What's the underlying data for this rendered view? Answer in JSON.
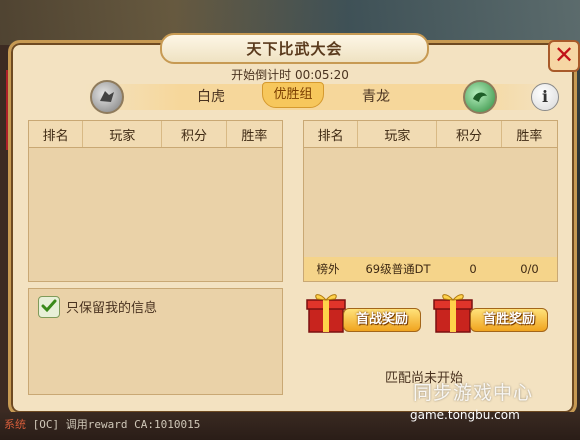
{
  "title": "天下比武大会",
  "countdown": "开始倒计时 00:05:20",
  "teams": {
    "left": "白虎",
    "right": "青龙"
  },
  "group_tab": "优胜组",
  "table_headers": [
    "排名",
    "玩家",
    "积分",
    "胜率"
  ],
  "my_row": {
    "rank": "榜外",
    "player": "69级普通DT",
    "score": "0",
    "win_rate": "0/0"
  },
  "only_my_info_label": "只保留我的信息",
  "only_my_info_checked": true,
  "rewards": {
    "first_battle": "首战奖励",
    "first_win": "首胜奖励"
  },
  "match_status": "匹配尚未开始",
  "chat": {
    "channel": "系统",
    "text": "[OC] 调用reward CA:1010015"
  },
  "watermark": {
    "title": "同步游戏中心",
    "url": "game.tongbu.com"
  },
  "icons": {
    "close": "close-icon",
    "info": "info-icon",
    "left_team": "white-tiger-emblem-icon",
    "right_team": "azure-dragon-emblem-icon"
  },
  "colors": {
    "accent": "#f7c75c",
    "close": "#c0121a",
    "panel": "#ead2a8"
  }
}
